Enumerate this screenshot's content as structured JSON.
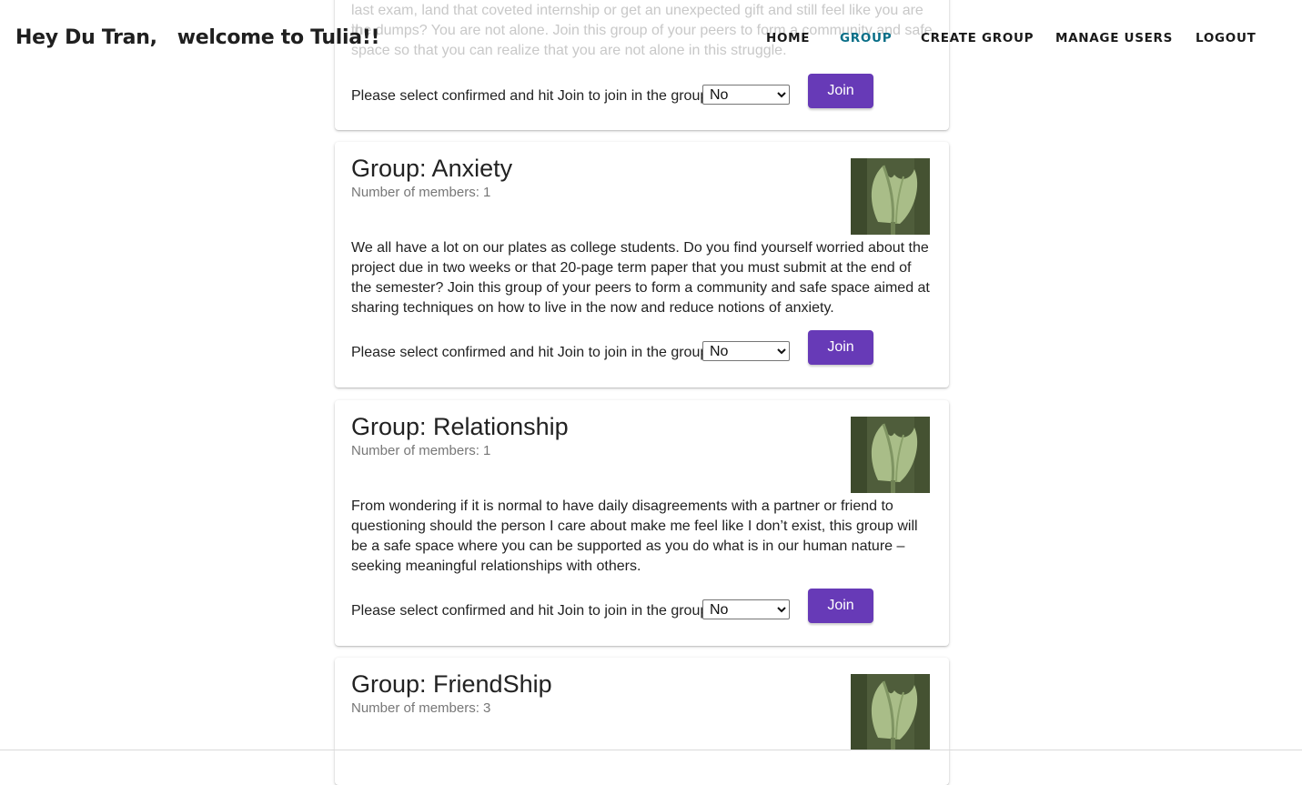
{
  "header": {
    "greeting": "Hey Du Tran,   welcome to Tulia!!",
    "nav": [
      {
        "label": "HOME",
        "active": false
      },
      {
        "label": "GROUP",
        "active": true
      },
      {
        "label": "CREATE GROUP",
        "active": false
      },
      {
        "label": "MANAGE USERS",
        "active": false
      },
      {
        "label": "LOGOUT",
        "active": false
      }
    ]
  },
  "colors": {
    "accent_nav": "#0a6f88",
    "join_button": "#673ab7"
  },
  "partial_card": {
    "ghost_lines": [
      "last exam, land that coveted internship or get an unexpected gift and still feel like you are in",
      "the dumps? You are not alone. Join this group of your peers to form a community and safe",
      "space so that you can realize that you are not alone in this struggle."
    ],
    "join_prompt": "Please select confirmed and hit Join to join in the group",
    "select_value": "No",
    "join_label": "Join"
  },
  "groups": [
    {
      "title": "Group: Anxiety",
      "members": "Number of members: 1",
      "image_icon": "tulip-image",
      "description": "We all have a lot on our plates as college students. Do you find yourself worried about the project due in two weeks or that 20-page term paper that you must submit at the end of the semester? Join this group of your peers to form a community and safe space aimed at sharing techniques on how to live in the now and reduce notions of anxiety.",
      "join_prompt": "Please select confirmed and hit Join to join in the group",
      "select_value": "No",
      "join_label": "Join"
    },
    {
      "title": "Group: Relationship",
      "members": "Number of members: 1",
      "image_icon": "tulip-image",
      "description": "From wondering if it is normal to have daily disagreements with a partner or friend to questioning should the person I care about make me feel like I don’t exist, this group will be a safe space where you can be supported as you do what is in our human nature – seeking meaningful relationships with others.",
      "join_prompt": "Please select confirmed and hit Join to join in the group",
      "select_value": "No",
      "join_label": "Join"
    },
    {
      "title": "Group: FriendShip",
      "members": "Number of members: 3",
      "image_icon": "tulip-image"
    }
  ]
}
